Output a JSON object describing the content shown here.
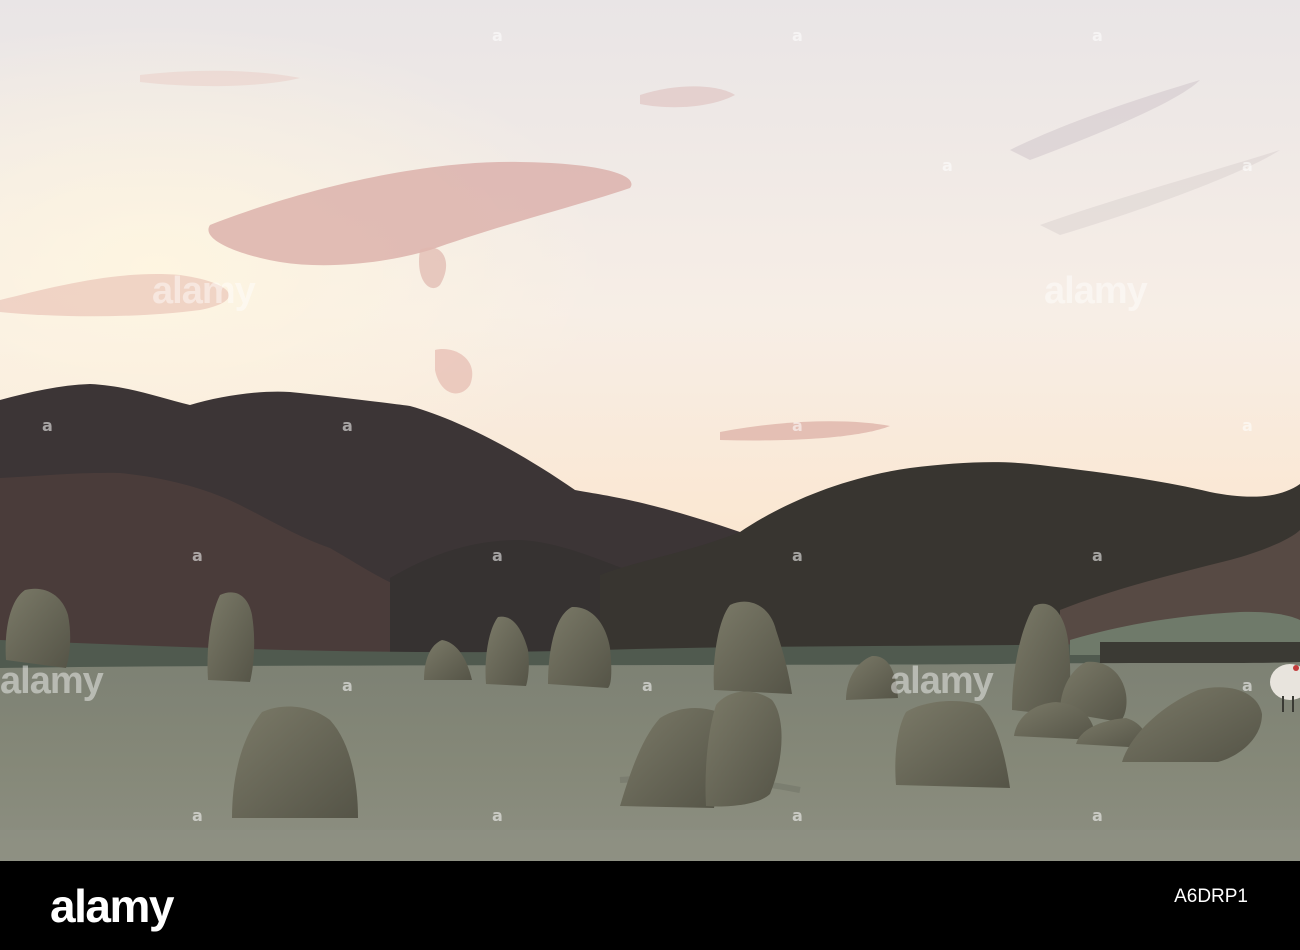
{
  "watermark": {
    "brand": "alamy",
    "tile_glyph": "a"
  },
  "footer": {
    "brand": "alamy",
    "image_id": "A6DRP1"
  },
  "colors": {
    "sky_top": "#ebe6e4",
    "sky_glow": "#fbe7cc",
    "cloud_pink": "#d8a8a0",
    "hills_dark": "#3a3434",
    "hills_mid": "#4a413e",
    "field": "#7c8074",
    "stone": "#6b6a5c",
    "footer_bg": "#000000"
  }
}
